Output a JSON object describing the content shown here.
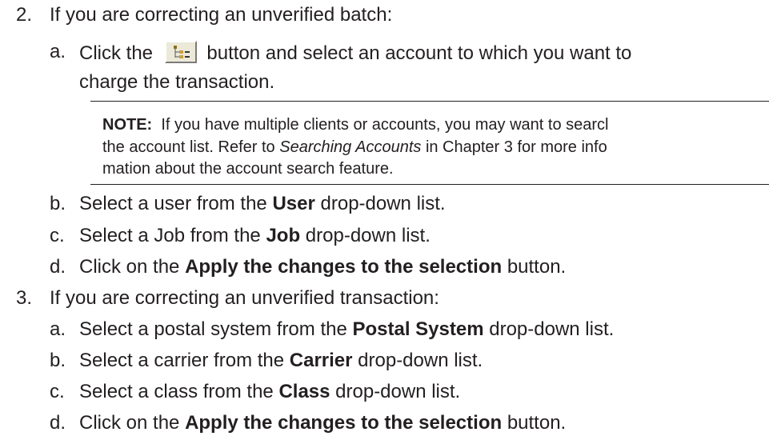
{
  "step2": {
    "number": "2.",
    "text": "If you are correcting an unverified batch:",
    "a": {
      "label": "a.",
      "part1": "Click the",
      "part2": "button and select an account to which you want to",
      "line2": "charge the transaction.",
      "button_icon": "account-tree-icon"
    },
    "note": {
      "label": "NOTE:",
      "line1": "If you have multiple clients or accounts, you may want to searcl",
      "line2_pre": "the account list. Refer to",
      "line2_ital": "Searching Accounts",
      "line2_post": "in Chapter 3 for more info",
      "line3": "mation about the account search feature."
    },
    "b": {
      "label": "b.",
      "pre": "Select a user from the",
      "bold": "User",
      "post": "drop-down list."
    },
    "c": {
      "label": "c.",
      "pre": "Select a Job from the",
      "bold": "Job",
      "post": "drop-down list."
    },
    "d": {
      "label": "d.",
      "pre": "Click on the",
      "bold": "Apply the changes to the selection",
      "post": "button."
    }
  },
  "step3": {
    "number": "3.",
    "text": "If you are correcting an unverified transaction:",
    "a": {
      "label": "a.",
      "pre": "Select a postal system from the",
      "bold": "Postal System",
      "post": "drop-down list."
    },
    "b": {
      "label": "b.",
      "pre": "Select a carrier from the",
      "bold": "Carrier",
      "post": "drop-down list."
    },
    "c": {
      "label": "c.",
      "pre": "Select a class from the",
      "bold": "Class",
      "post": "drop-down list."
    },
    "d": {
      "label": "d.",
      "pre": "Click on the",
      "bold": "Apply the changes to the selection",
      "post": "button."
    }
  }
}
